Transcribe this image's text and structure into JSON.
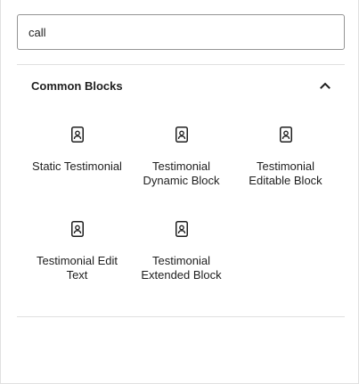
{
  "search": {
    "value": "call",
    "placeholder": "Search"
  },
  "section": {
    "title": "Common Blocks",
    "toggle_icon": "chevron-up-icon",
    "expanded": true
  },
  "blocks": [
    {
      "label": "Static Testimonial",
      "icon": "block-default-icon"
    },
    {
      "label": "Testimonial Dynamic Block",
      "icon": "block-default-icon"
    },
    {
      "label": "Testimonial Editable Block",
      "icon": "block-default-icon"
    },
    {
      "label": "Testimonial Edit Text",
      "icon": "block-default-icon"
    },
    {
      "label": "Testimonial Extended Block",
      "icon": "block-default-icon"
    }
  ],
  "colors": {
    "text": "#1e1e1e",
    "border": "#949494",
    "divider": "#e0e0e0"
  }
}
